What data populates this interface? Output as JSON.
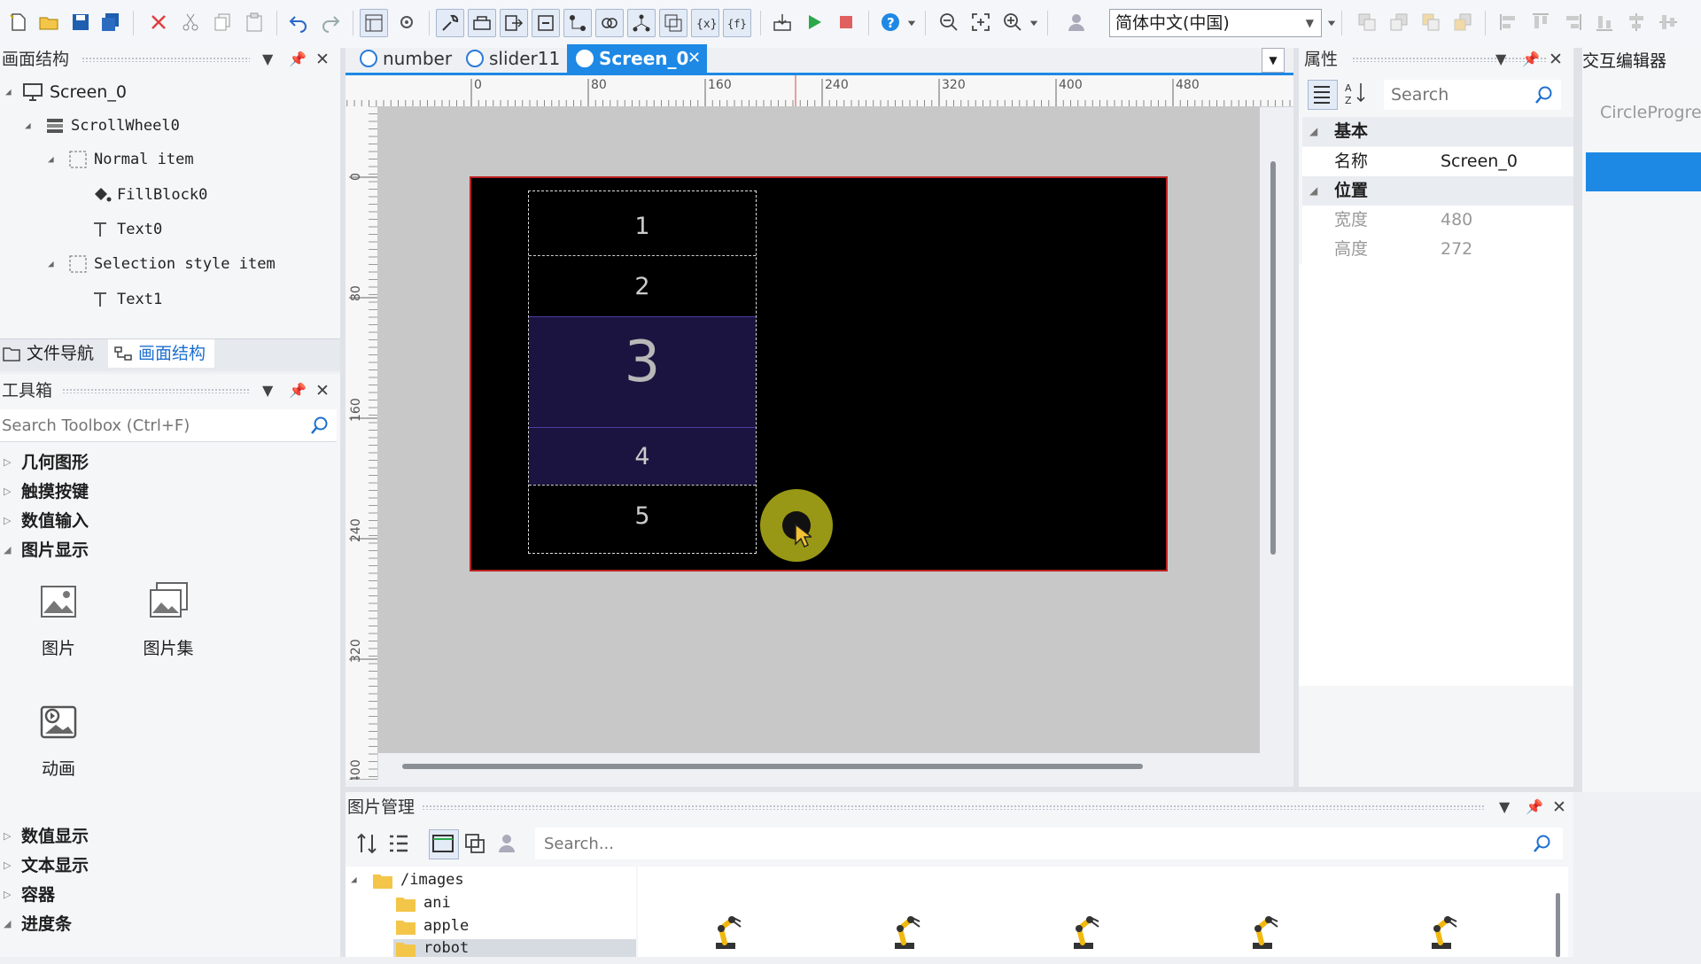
{
  "toolbar": {
    "language": "简体中文(中国)"
  },
  "left_structure": {
    "title": "画面结构",
    "tree": [
      {
        "label": "Screen_0",
        "icon": "monitor-icon"
      },
      {
        "label": "ScrollWheel0",
        "icon": "scrollwheel-icon"
      },
      {
        "label": "Normal item",
        "icon": "dashed-box-icon"
      },
      {
        "label": "FillBlock0",
        "icon": "paint-bucket-icon"
      },
      {
        "label": "Text0",
        "icon": "text-icon"
      },
      {
        "label": "Selection style item",
        "icon": "dashed-box-icon"
      },
      {
        "label": "Text1",
        "icon": "text-icon"
      }
    ],
    "tabs": [
      "文件导航",
      "画面结构"
    ]
  },
  "toolbox": {
    "title": "工具箱",
    "search_placeholder": "Search Toolbox (Ctrl+F)",
    "categories_top": [
      "几何图形",
      "触摸按键",
      "数值输入",
      "图片显示"
    ],
    "tools": [
      {
        "label": "图片",
        "icon": "image-icon"
      },
      {
        "label": "图片集",
        "icon": "image-set-icon"
      },
      {
        "label": "动画",
        "icon": "animation-icon"
      }
    ],
    "categories_bottom": [
      "数值显示",
      "文本显示",
      "容器",
      "进度条"
    ]
  },
  "doc_tabs": [
    {
      "label": "number",
      "active": false
    },
    {
      "label": "slider11",
      "active": false
    },
    {
      "label": "Screen_0",
      "active": true
    }
  ],
  "ruler": {
    "h_ticks": [
      "0",
      "80",
      "160",
      "240",
      "320",
      "400",
      "480"
    ],
    "v_ticks": [
      "0",
      "80",
      "160",
      "240",
      "320",
      "400"
    ]
  },
  "canvas": {
    "wheel_items": [
      "1",
      "2",
      "3",
      "4",
      "5"
    ],
    "selected_index": 2,
    "colors": {
      "screen_border": "#b22222",
      "selection_fill": "#1c1440",
      "cursor_highlight": "#b8b820"
    }
  },
  "properties": {
    "title": "属性",
    "search_placeholder": "Search",
    "group_basic": "基本",
    "name_key": "名称",
    "name_value": "Screen_0",
    "group_position": "位置",
    "width_key": "宽度",
    "width_value": "480",
    "height_key": "高度",
    "height_value": "272"
  },
  "interaction_editor": {
    "title": "交互编辑器",
    "item_label": "CircleProgre"
  },
  "image_manager": {
    "title": "图片管理",
    "search_placeholder": "Search...",
    "folders": [
      {
        "label": "/images"
      },
      {
        "label": "ani"
      },
      {
        "label": "apple"
      },
      {
        "label": "robot"
      }
    ]
  }
}
